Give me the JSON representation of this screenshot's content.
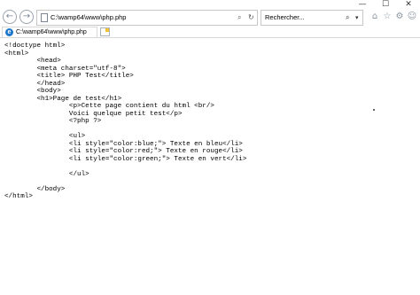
{
  "window": {
    "minimize_glyph": "—",
    "maximize_glyph": "☐",
    "close_glyph": "✕"
  },
  "toolbar": {
    "back_glyph": "←",
    "forward_glyph": "→",
    "address": "C:\\wamp64\\www\\php.php",
    "address_search_glyph": "⌕",
    "refresh_glyph": "↻",
    "search_placeholder": "Rechercher...",
    "search_glyph": "⌕",
    "dropdown_glyph": "▾",
    "home_glyph": "⌂",
    "favorites_glyph": "☆",
    "settings_glyph": "⚙",
    "feedback_glyph": "☺"
  },
  "tabs": [
    {
      "label": "C:\\wamp64\\www\\php.php",
      "icon": "e"
    }
  ],
  "code_lines": [
    "<!doctype html>",
    "<html>",
    "        <head>",
    "        <meta charset=\"utf-8\">",
    "        <title> PHP Test</title>",
    "        </head>",
    "        <body>",
    "        <h1>Page de test</h1>",
    "                <p>Cette page contient du html <br/>",
    "                Voici quelque petit test</p>",
    "                <?php ?>",
    "",
    "                <ul>",
    "                <li style=\"color:blue;\"> Texte en bleu</li>",
    "                <li style=\"color:red;\"> Texte en rouge</li>",
    "                <li style=\"color:green;\"> Texte en vert</li>",
    "",
    "                </ul>",
    "",
    "        </body>",
    "</html>"
  ]
}
